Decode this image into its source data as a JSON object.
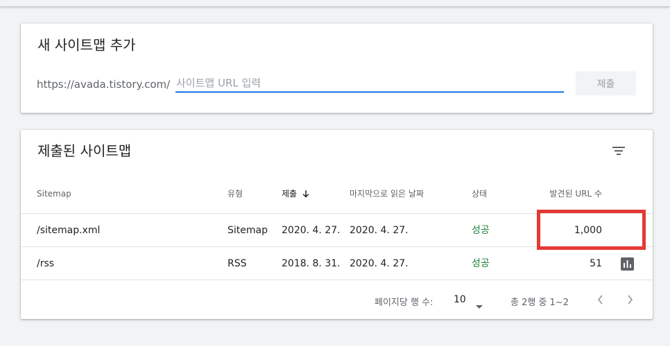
{
  "add_card": {
    "title": "새 사이트맵 추가",
    "url_prefix": "https://avada.tistory.com/",
    "input_value": "",
    "input_placeholder": "사이트맵 URL 입력",
    "submit_label": "제출"
  },
  "list_card": {
    "title": "제출된 사이트맵",
    "filter_icon": "filter-list-icon",
    "columns": {
      "sitemap": "Sitemap",
      "type": "유형",
      "submitted": "제출",
      "last_read": "마지막으로 읽은 날짜",
      "status": "상태",
      "discovered": "발견된 URL 수"
    },
    "sort_icon": "arrow-down-icon",
    "rows": [
      {
        "sitemap": "/sitemap.xml",
        "type": "Sitemap",
        "submitted": "2020. 4. 27.",
        "last_read": "2020. 4. 27.",
        "status": "성공",
        "discovered": "1,000"
      },
      {
        "sitemap": "/rss",
        "type": "RSS",
        "submitted": "2018. 8. 31.",
        "last_read": "2020. 4. 27.",
        "status": "성공",
        "discovered": "51"
      }
    ],
    "pagination": {
      "rows_per_page_label": "페이지당 행 수:",
      "rows_per_page_value": "10",
      "range_text": "총 2행 중 1~2"
    }
  },
  "colors": {
    "accent": "#1a73e8",
    "success": "#188038",
    "highlight": "#e53935",
    "background": "#f1f3f4"
  }
}
